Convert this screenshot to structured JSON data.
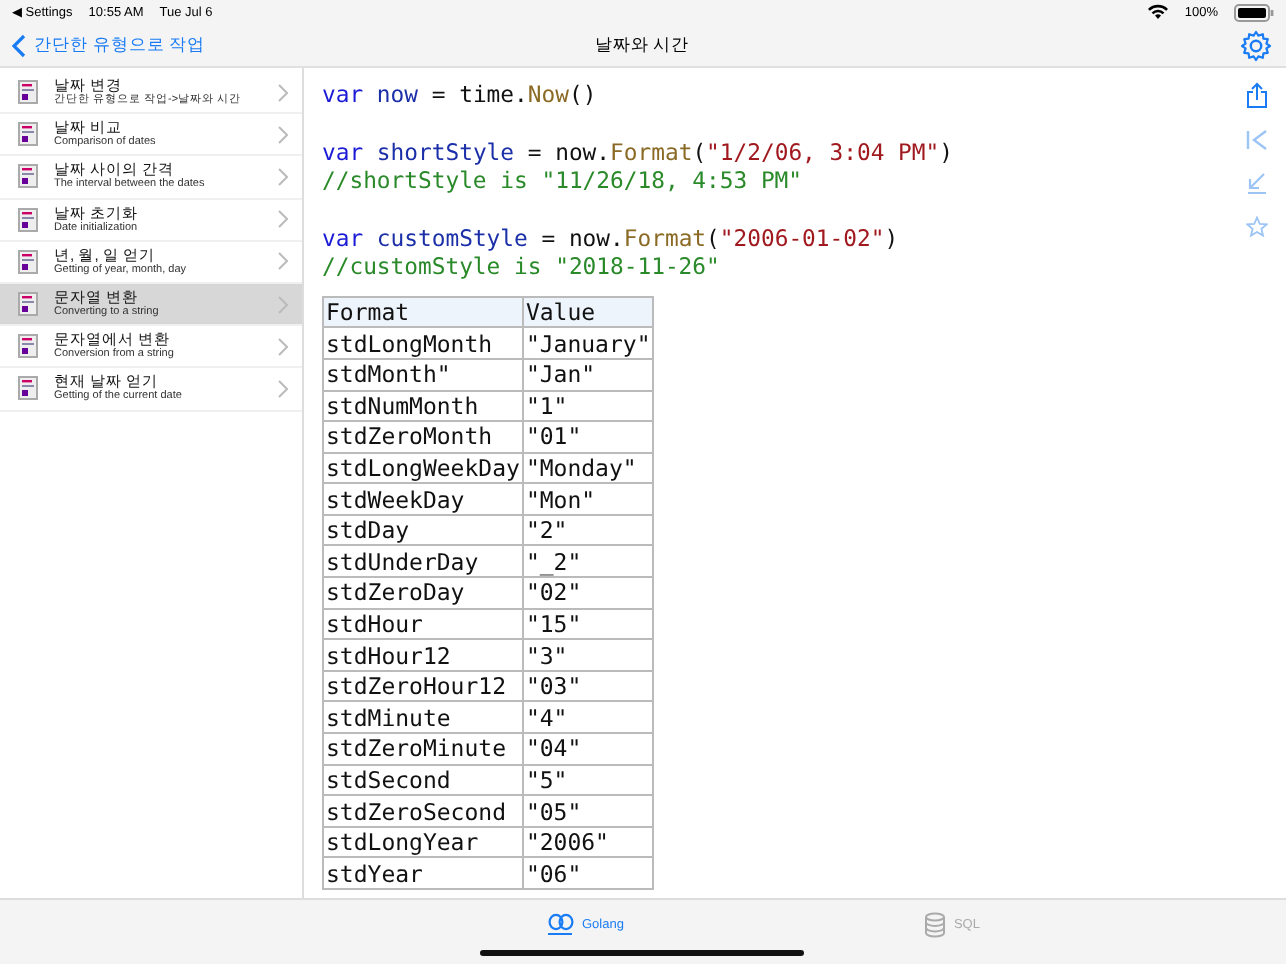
{
  "status_bar": {
    "back_app": "◀ Settings",
    "time": "10:55 AM",
    "date": "Tue Jul 6",
    "battery": "100%"
  },
  "nav": {
    "back": "간단한 유형으로 작업",
    "title": "날짜와 시간"
  },
  "sidebar": {
    "items": [
      {
        "title": "날짜 변경",
        "subtitle": "간단한 유형으로 작업->날짜와 시간",
        "selected": false
      },
      {
        "title": "날짜 비교",
        "subtitle": "Comparison of dates",
        "selected": false
      },
      {
        "title": "날짜 사이의 간격",
        "subtitle": "The interval between the dates",
        "selected": false
      },
      {
        "title": "날짜 초기화",
        "subtitle": "Date initialization",
        "selected": false
      },
      {
        "title": "년, 월, 일 얻기",
        "subtitle": "Getting of year, month, day",
        "selected": false
      },
      {
        "title": "문자열 변환",
        "subtitle": "Converting to a string",
        "selected": true
      },
      {
        "title": "문자열에서 변환",
        "subtitle": "Conversion from a string",
        "selected": false
      },
      {
        "title": "현재 날짜 얻기",
        "subtitle": "Getting of the current date",
        "selected": false
      }
    ]
  },
  "code": {
    "blocks": [
      [
        [
          {
            "kind": "keyword",
            "text": "var"
          },
          {
            "kind": "ident",
            "text": " now"
          },
          {
            "kind": "plain",
            "text": " = time."
          },
          {
            "kind": "func",
            "text": "Now"
          },
          {
            "kind": "plain",
            "text": "()"
          }
        ]
      ],
      [
        [
          {
            "kind": "keyword",
            "text": "var"
          },
          {
            "kind": "ident",
            "text": " shortStyle"
          },
          {
            "kind": "plain",
            "text": " = now."
          },
          {
            "kind": "func",
            "text": "Format"
          },
          {
            "kind": "plain",
            "text": "("
          },
          {
            "kind": "string",
            "text": "\"1/2/06, 3:04 PM\""
          },
          {
            "kind": "plain",
            "text": ")"
          }
        ],
        [
          {
            "kind": "comment",
            "text": "//shortStyle is \"11/26/18, 4:53 PM\""
          }
        ]
      ],
      [
        [
          {
            "kind": "keyword",
            "text": "var"
          },
          {
            "kind": "ident",
            "text": " customStyle"
          },
          {
            "kind": "plain",
            "text": " = now."
          },
          {
            "kind": "func",
            "text": "Format"
          },
          {
            "kind": "plain",
            "text": "("
          },
          {
            "kind": "string",
            "text": "\"2006-01-02\""
          },
          {
            "kind": "plain",
            "text": ")"
          }
        ],
        [
          {
            "kind": "comment",
            "text": "//customStyle is \"2018-11-26\""
          }
        ]
      ]
    ]
  },
  "table": {
    "columns": [
      "Format",
      "Value"
    ],
    "rows": [
      [
        "stdLongMonth",
        "\"January\""
      ],
      [
        "stdMonth\"",
        "\"Jan\""
      ],
      [
        "stdNumMonth",
        "\"1\""
      ],
      [
        "stdZeroMonth",
        "\"01\""
      ],
      [
        "stdLongWeekDay",
        "\"Monday\""
      ],
      [
        "stdWeekDay",
        "\"Mon\""
      ],
      [
        "stdDay",
        "\"2\""
      ],
      [
        "stdUnderDay",
        "\"_2\""
      ],
      [
        "stdZeroDay",
        "\"02\""
      ],
      [
        "stdHour",
        "\"15\""
      ],
      [
        "stdHour12",
        "\"3\""
      ],
      [
        "stdZeroHour12",
        "\"03\""
      ],
      [
        "stdMinute",
        "\"4\""
      ],
      [
        "stdZeroMinute",
        "\"04\""
      ],
      [
        "stdSecond",
        "\"5\""
      ],
      [
        "stdZeroSecond",
        "\"05\""
      ],
      [
        "stdLongYear",
        "\"2006\""
      ],
      [
        "stdYear",
        "\"06\""
      ]
    ]
  },
  "tab_bar": [
    {
      "label": "Golang",
      "selected": true,
      "kind": "golang"
    },
    {
      "label": "SQL",
      "selected": false,
      "kind": "sql"
    }
  ]
}
